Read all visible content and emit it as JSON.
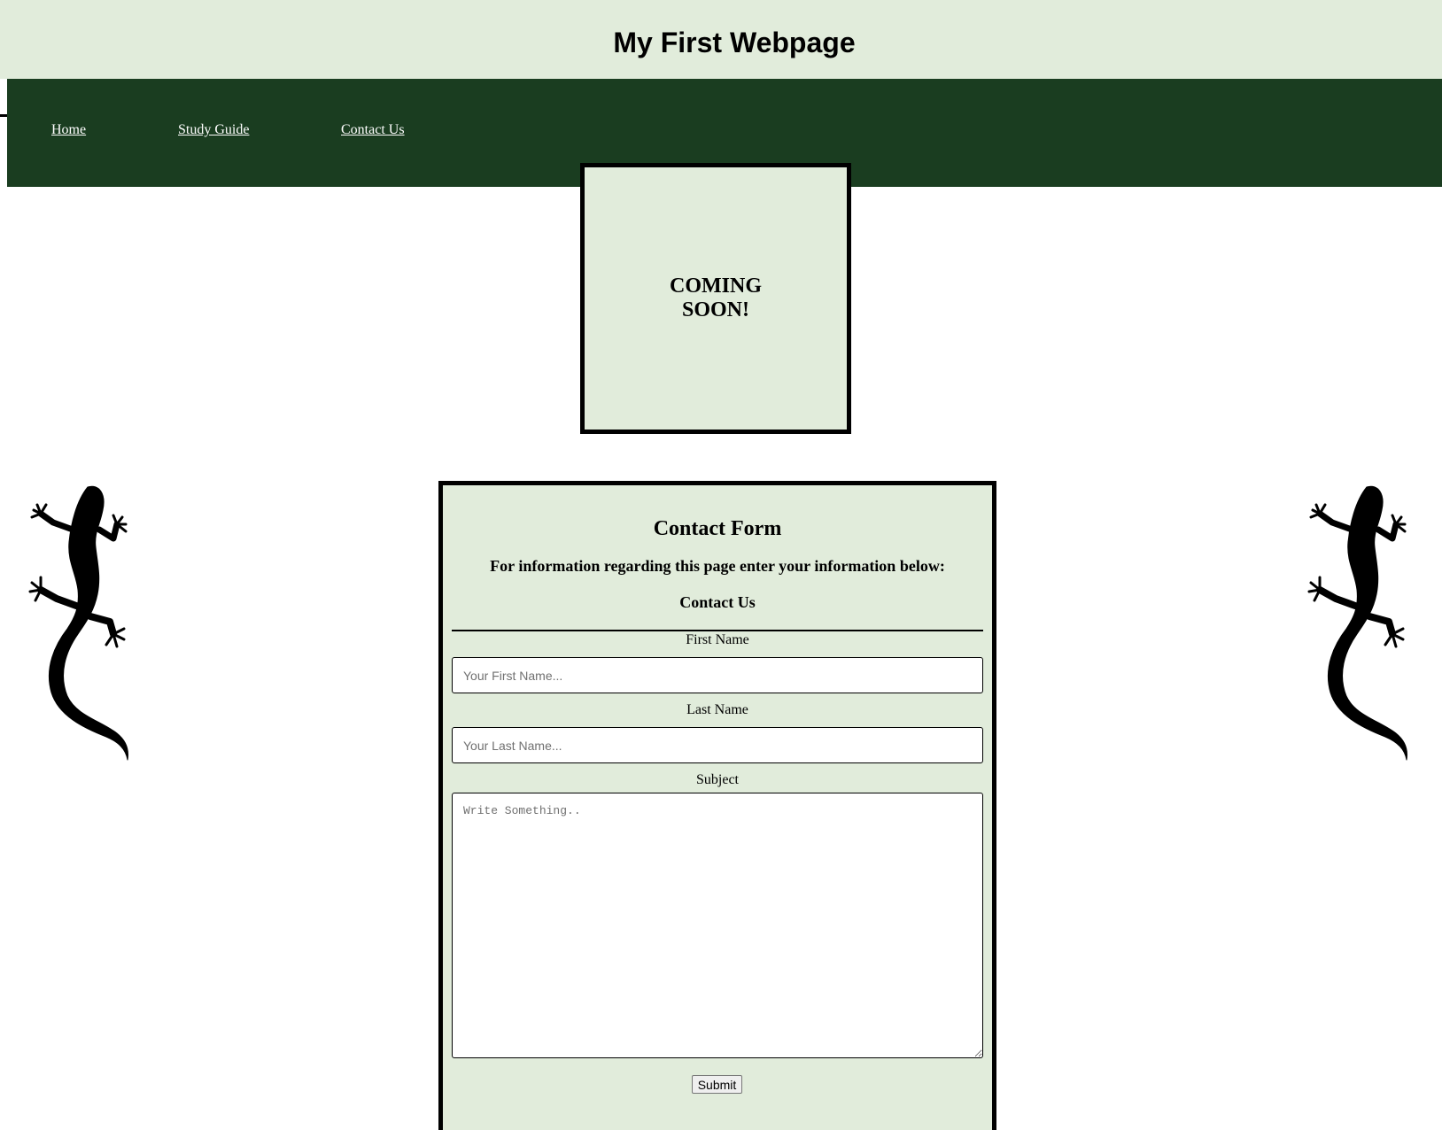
{
  "header": {
    "title": "My First Webpage"
  },
  "nav": {
    "items": [
      {
        "label": "Home"
      },
      {
        "label": "Study Guide"
      },
      {
        "label": "Contact Us"
      }
    ]
  },
  "banner": {
    "text": "COMING SOON!"
  },
  "decorations": {
    "left_icon": "gecko-icon",
    "right_icon": "gecko-icon"
  },
  "form": {
    "title": "Contact Form",
    "description": "For information regarding this page enter your information below:",
    "subtitle": "Contact Us",
    "first_name": {
      "label": "First Name",
      "placeholder": "Your First Name..."
    },
    "last_name": {
      "label": "Last Name",
      "placeholder": "Your Last Name..."
    },
    "subject": {
      "label": "Subject",
      "placeholder": "Write Something.."
    },
    "submit_label": "Submit"
  },
  "colors": {
    "header_bg": "#e1ecdb",
    "nav_bg": "#1a3d20",
    "panel_bg": "#e1ecdb",
    "nav_text": "#ffffff"
  }
}
